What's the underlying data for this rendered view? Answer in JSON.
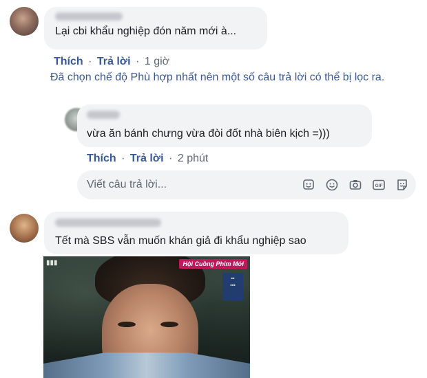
{
  "comments": [
    {
      "text": "Lại cbi khẩu nghiệp đón năm mới à...",
      "actions": {
        "like": "Thích",
        "reply": "Trả lời",
        "time": "1 giờ"
      }
    },
    {
      "text": "vừa ăn bánh chưng vừa đòi đốt nhà biên kịch =)))",
      "actions": {
        "like": "Thích",
        "reply": "Trả lời",
        "time": "2 phút"
      }
    },
    {
      "text": "Tết mà SBS vẫn muốn khán giả đi khẩu nghiệp sao"
    }
  ],
  "filter_notice": "Đã chọn chế độ Phù hợp nhất nên một số câu trả lời có thể bị lọc ra.",
  "reply_box": {
    "placeholder": "Viết câu trả lời...",
    "icons": [
      "sticker-icon",
      "emoji-icon",
      "camera-icon",
      "gif-icon",
      "sticker-face-icon"
    ]
  },
  "media": {
    "banner": "Hội Cuồng Phim Mới"
  },
  "separator": " · "
}
